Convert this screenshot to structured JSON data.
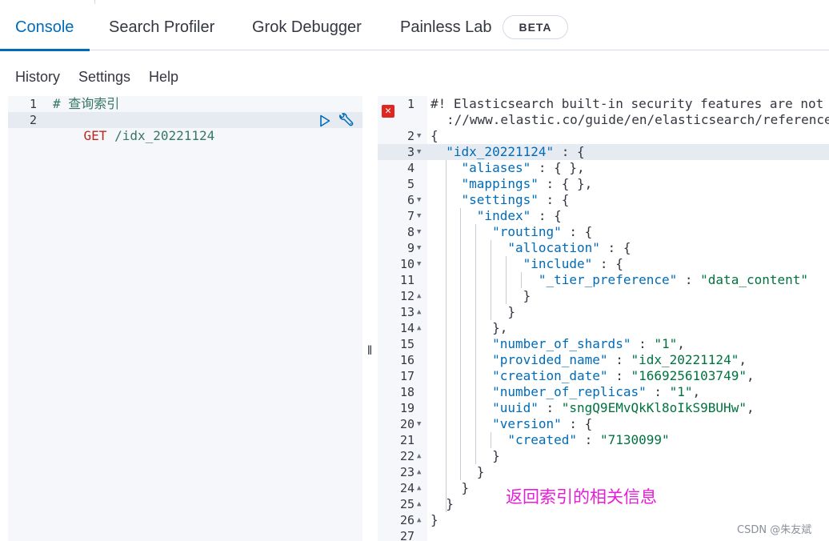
{
  "tabs": [
    {
      "label": "Console",
      "selected": true
    },
    {
      "label": "Search Profiler"
    },
    {
      "label": "Grok Debugger"
    },
    {
      "label": "Painless Lab"
    }
  ],
  "beta_badge": "BETA",
  "menu": {
    "history": "History",
    "settings": "Settings",
    "help": "Help"
  },
  "request_editor": {
    "line_numbers": [
      "1",
      "2"
    ],
    "comment": "# 查询索引",
    "method": "GET",
    "path": "/idx_20221124"
  },
  "response_editor": {
    "line_numbers": [
      "1",
      "2",
      "3",
      "4",
      "5",
      "6",
      "7",
      "8",
      "9",
      "10",
      "11",
      "12",
      "13",
      "14",
      "15",
      "16",
      "17",
      "18",
      "19",
      "20",
      "21",
      "22",
      "23",
      "24",
      "25",
      "26",
      "27"
    ],
    "warning_line": "#! Elasticsearch built-in security features are not e",
    "warning_line_cont": "://www.elastic.co/guide/en/elasticsearch/reference/",
    "index_name": "\"idx_20221124\"",
    "keys": {
      "aliases": "\"aliases\"",
      "mappings": "\"mappings\"",
      "settings": "\"settings\"",
      "index": "\"index\"",
      "routing": "\"routing\"",
      "allocation": "\"allocation\"",
      "include": "\"include\"",
      "tier_preference": "\"_tier_preference\"",
      "number_of_shards": "\"number_of_shards\"",
      "provided_name": "\"provided_name\"",
      "creation_date": "\"creation_date\"",
      "number_of_replicas": "\"number_of_replicas\"",
      "uuid": "\"uuid\"",
      "version": "\"version\"",
      "created": "\"created\""
    },
    "values": {
      "tier_preference": "\"data_content\"",
      "number_of_shards": "\"1\"",
      "provided_name": "\"idx_20221124\"",
      "creation_date": "\"1669256103749\"",
      "number_of_replicas": "\"1\"",
      "uuid": "\"sngQ9EMvQkKl8oIkS9BUHw\"",
      "created": "\"7130099\""
    }
  },
  "annotation": "返回索引的相关信息",
  "watermark": "CSDN @朱友斌"
}
